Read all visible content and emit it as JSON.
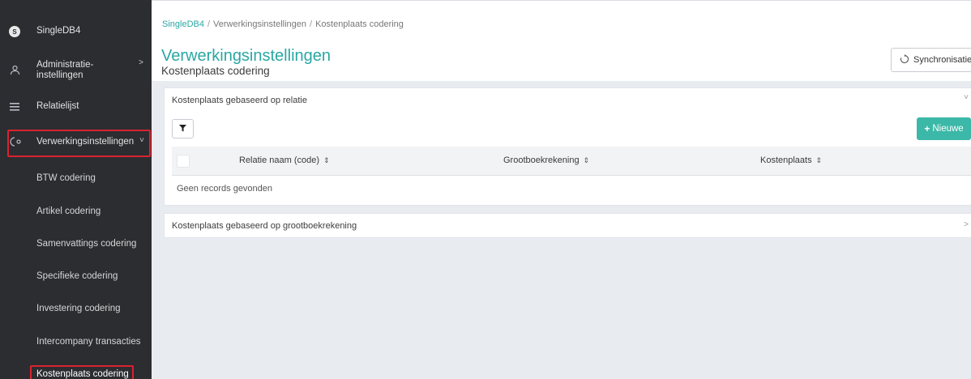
{
  "sidebar": {
    "app": {
      "icon": "s-logo-icon",
      "logo_letter": "S",
      "label": "SingleDB4"
    },
    "items": [
      {
        "icon": "user-settings-icon",
        "label": "Administratie-\ninstellingen",
        "chevron": ">"
      },
      {
        "icon": "list-icon",
        "label": "Relatielijst"
      },
      {
        "icon": "process-settings-icon",
        "label": "Verwerkingsinstellingen",
        "chevron": "˅"
      }
    ],
    "sub_items": [
      "BTW codering",
      "Artikel codering",
      "Samenvattings codering",
      "Specifieke codering",
      "Investering codering",
      "Intercompany transacties",
      "Kostenplaats codering"
    ],
    "highlight_color": "#d9232e"
  },
  "header": {
    "breadcrumb": [
      "SingleDB4",
      "Verwerkingsinstellingen",
      "Kostenplaats codering"
    ],
    "title": "Verwerkingsinstellingen",
    "subtitle": "Kostenplaats codering",
    "sync_label": "Synchronisatie",
    "sync_icon": "sync-icon"
  },
  "panels": {
    "relatie": {
      "title": "Kostenplaats gebaseerd op relatie",
      "chevron": "˅",
      "filter_icon": "filter-icon",
      "new_label": "Nieuwe",
      "columns": [
        "Relatie naam (code)",
        "Grootboekrekening",
        "Kostenplaats"
      ],
      "empty": "Geen records gevonden"
    },
    "grootboek": {
      "title": "Kostenplaats gebaseerd op grootboekrekening",
      "chevron": ">"
    }
  },
  "colors": {
    "accent": "#2aa7a4",
    "button_primary": "#3bb8a7",
    "sidebar_bg": "#2b2d31",
    "page_bg": "#e8ebf0"
  }
}
